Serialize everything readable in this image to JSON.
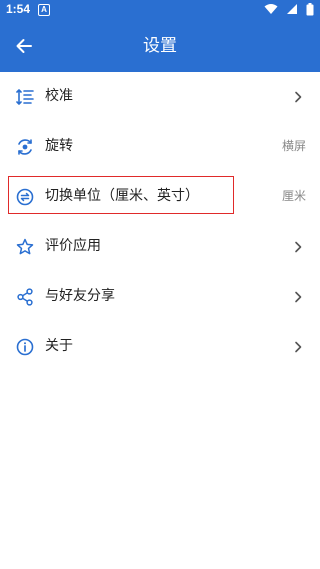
{
  "status": {
    "time": "1:54",
    "notif_letter": "A"
  },
  "appbar": {
    "title": "设置"
  },
  "colors": {
    "primary": "#2a6fd1",
    "highlight": "#e02a2a"
  },
  "list": [
    {
      "label": "校准",
      "icon": "calibrate-icon",
      "trailing": "chevron"
    },
    {
      "label": "旋转",
      "icon": "rotate-icon",
      "value": "横屏"
    },
    {
      "label": "切换单位（厘米、英寸）",
      "icon": "switch-unit-icon",
      "value": "厘米"
    },
    {
      "label": "评价应用",
      "icon": "star-icon",
      "trailing": "chevron"
    },
    {
      "label": "与好友分享",
      "icon": "share-icon",
      "trailing": "chevron"
    },
    {
      "label": "关于",
      "icon": "info-icon",
      "trailing": "chevron"
    }
  ]
}
